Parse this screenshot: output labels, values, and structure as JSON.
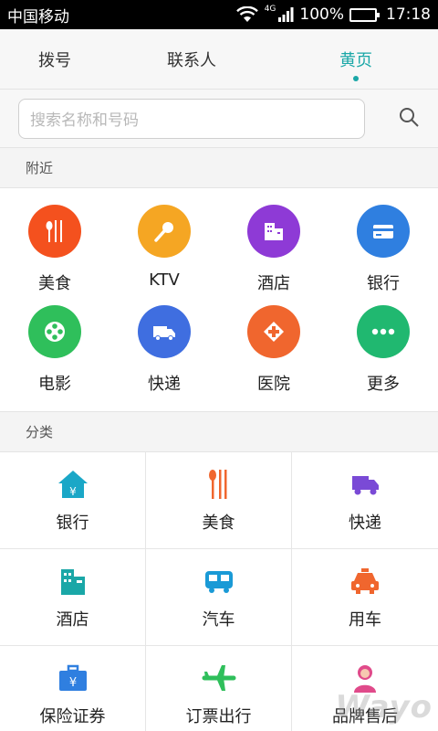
{
  "status_bar": {
    "carrier": "中国移动",
    "network": "4G",
    "battery": "100%",
    "time": "17:18"
  },
  "tabs": [
    {
      "label": "拨号",
      "active": false
    },
    {
      "label": "联系人",
      "active": false
    },
    {
      "label": "黄页",
      "active": true
    }
  ],
  "search": {
    "placeholder": "搜索名称和号码"
  },
  "nearby": {
    "title": "附近",
    "items": [
      {
        "label": "美食",
        "icon": "utensils-icon",
        "color": "#f4511e"
      },
      {
        "label": "KTV",
        "icon": "microphone-icon",
        "color": "#f5a623"
      },
      {
        "label": "酒店",
        "icon": "hotel-icon",
        "color": "#8e3ad6"
      },
      {
        "label": "银行",
        "icon": "bank-card-icon",
        "color": "#2f7fe0"
      },
      {
        "label": "电影",
        "icon": "film-reel-icon",
        "color": "#2fbf5b"
      },
      {
        "label": "快递",
        "icon": "delivery-truck-icon",
        "color": "#3f6ee0"
      },
      {
        "label": "医院",
        "icon": "hospital-icon",
        "color": "#f0662e"
      },
      {
        "label": "更多",
        "icon": "more-dots-icon",
        "color": "#20b870"
      }
    ]
  },
  "categories": {
    "title": "分类",
    "items": [
      {
        "label": "银行",
        "icon": "bank-icon",
        "color": "#1aa7c7"
      },
      {
        "label": "美食",
        "icon": "utensils-icon",
        "color": "#f0662e"
      },
      {
        "label": "快递",
        "icon": "delivery-truck-icon",
        "color": "#7a4ad6"
      },
      {
        "label": "酒店",
        "icon": "hotel-icon",
        "color": "#1aa7a7"
      },
      {
        "label": "汽车",
        "icon": "bus-icon",
        "color": "#1a9ad6"
      },
      {
        "label": "用车",
        "icon": "taxi-icon",
        "color": "#f0662e"
      },
      {
        "label": "保险证券",
        "icon": "briefcase-icon",
        "color": "#2f7fe0"
      },
      {
        "label": "订票出行",
        "icon": "airplane-icon",
        "color": "#2fbf5b"
      },
      {
        "label": "品牌售后",
        "icon": "customer-service-icon",
        "color": "#e04a8a"
      }
    ]
  },
  "watermark": "Wayo"
}
